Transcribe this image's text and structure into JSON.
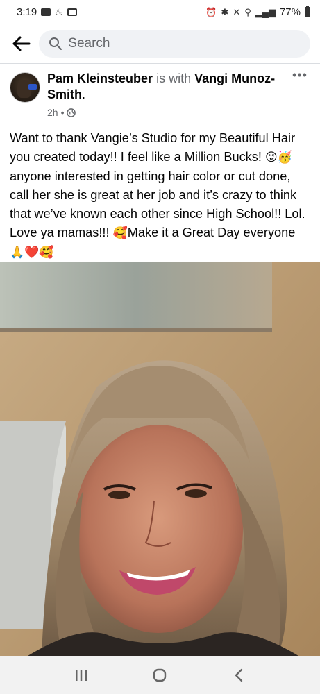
{
  "status_bar": {
    "time": "3:19",
    "battery": "77%"
  },
  "header": {
    "search_placeholder": "Search"
  },
  "post": {
    "author": "Pam Kleinsteuber",
    "connector": "is with",
    "tagged": "Vangi Munoz-Smith",
    "tagged_suffix": ".",
    "time": "2h",
    "time_separator": "•",
    "text_line_1": "Want to thank Vangie’s Studio for my Beautiful Hair you created today!! I feel like a Million Bucks!",
    "emoji_1": "😜🥳",
    "text_line_2": " anyone interested in getting hair color or cut done, call her she is great at her job and it’s crazy to think that we’ve known each other since High School!! Lol. Love ya mamas!!!",
    "emoji_2": "🥰",
    "text_line_3": "Make it a Great Day everyone ",
    "emoji_3": "🙏❤️🥰"
  },
  "icons": {
    "back": "back-arrow-icon",
    "search": "search-icon",
    "more": "more-options-icon",
    "privacy": "globe-icon",
    "nav_recents": "recents-icon",
    "nav_home": "home-icon",
    "nav_back": "back-icon"
  },
  "colors": {
    "muted_text": "#65676b",
    "search_bg": "#f0f2f5"
  }
}
